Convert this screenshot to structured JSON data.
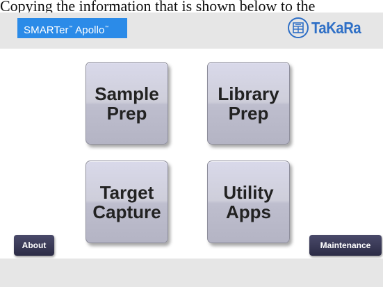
{
  "caption": "Copying the information that is shown below to the",
  "header": {
    "product_name": "SMARTer",
    "product_tm": "™",
    "product_name_2": " Apollo",
    "product_tm_2": "™",
    "company": "TaKaRa"
  },
  "tiles": {
    "sample_prep": {
      "line1": "Sample",
      "line2": "Prep"
    },
    "library_prep": {
      "line1": "Library",
      "line2": "Prep"
    },
    "target_capture": {
      "line1": "Target",
      "line2": "Capture"
    },
    "utility_apps": {
      "line1": "Utility",
      "line2": "Apps"
    }
  },
  "buttons": {
    "about": "About",
    "maintenance": "Maintenance"
  },
  "colors": {
    "brand_blue": "#2b8be8",
    "takara_blue": "#2e6fc6",
    "button_dark": "#2c2c46"
  }
}
